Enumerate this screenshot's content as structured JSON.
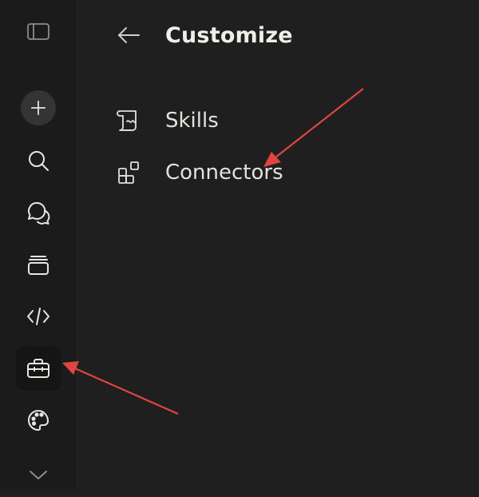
{
  "sidebar": {
    "items": [
      {
        "icon": "sidebar-toggle-icon"
      },
      {
        "icon": "plus-icon"
      },
      {
        "icon": "search-icon"
      },
      {
        "icon": "chat-bubbles-icon"
      },
      {
        "icon": "projects-stack-icon"
      },
      {
        "icon": "code-icon"
      },
      {
        "icon": "briefcase-icon",
        "active": true
      },
      {
        "icon": "palette-icon"
      },
      {
        "icon": "chevron-down-icon"
      }
    ]
  },
  "header": {
    "back_icon": "arrow-left-icon",
    "title": "Customize"
  },
  "menu": {
    "items": [
      {
        "label": "Skills",
        "icon": "scroll-icon"
      },
      {
        "label": "Connectors",
        "icon": "blocks-icon"
      }
    ]
  },
  "annotations": {
    "arrow_color": "#e0453f"
  },
  "colors": {
    "background": "#1f1f1f",
    "rail": "#1b1b1b",
    "text": "#e8e6e1"
  }
}
